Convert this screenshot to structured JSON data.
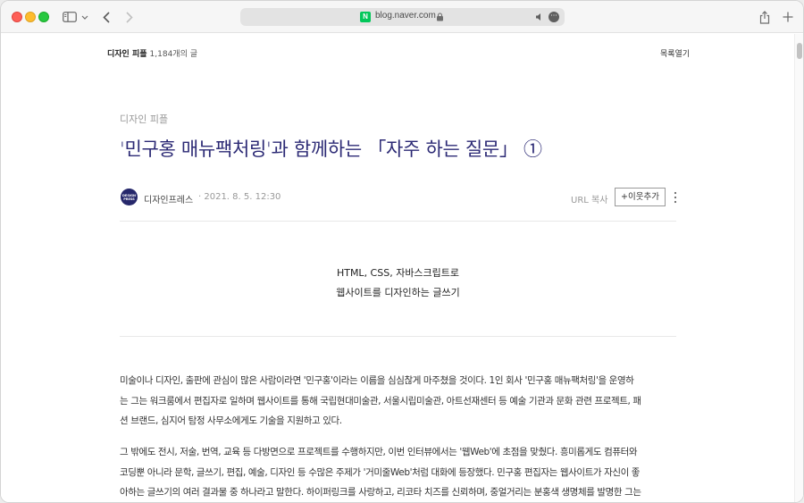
{
  "browser": {
    "url": "blog.naver.com",
    "favicon_letter": "N"
  },
  "blog": {
    "category_name": "디자인 피플",
    "post_count": "1,184개의 글",
    "list_toggle": "목록열기"
  },
  "post": {
    "category": "디자인 피플",
    "title": "'민구홍 매뉴팩처링'과 함께하는 「자주 하는 질문」 ①",
    "author": "디자인프레스",
    "date": "· 2021. 8. 5. 12:30",
    "avatar_text": "DESIGN PRESS",
    "url_copy": "URL 복사",
    "add_neighbor": "+이웃추가",
    "quote_lines": [
      "HTML, CSS, 자바스크립트로",
      "웹사이트를 디자인하는 글쓰기"
    ],
    "paragraphs": [
      [
        "미술이나 디자인, 출판에 관심이 많은 사람이라면 '민구홍'이라는 이름을 심심찮게 마주쳤을 것이다. 1인 회사 '민구홍 매뉴팩처링'을 운영하",
        "는 그는 워크룸에서 편집자로 일하며 웹사이트를 통해 국립현대미술관, 서울시립미술관, 아트선재센터 등 예술 기관과 문화 관련 프로젝트, 패",
        "션 브랜드, 심지어 탐정 사무소에게도 기술을 지원하고 있다."
      ],
      [
        "그 밖에도 전시, 저술, 번역, 교육 등 다방면으로 프로젝트를 수행하지만, 이번 인터뷰에서는 '웹Web'에 초점을 맞췄다. 흥미롭게도 컴퓨터와",
        "코딩뿐 아니라 문학, 글쓰기, 편집, 예술, 디자인 등 수많은 주제가 '거미줄Web'처럼 대화에 등장했다. 민구홍 편집자는 웹사이트가 자신이 좋",
        "아하는 글쓰기의 여러 결과물 중 하나라고 말한다. 하이퍼링크를 사랑하고, 리코타 치즈를 신뢰하며, 중얼거리는 분홍색 생명체를 발명한 그는"
      ]
    ]
  }
}
